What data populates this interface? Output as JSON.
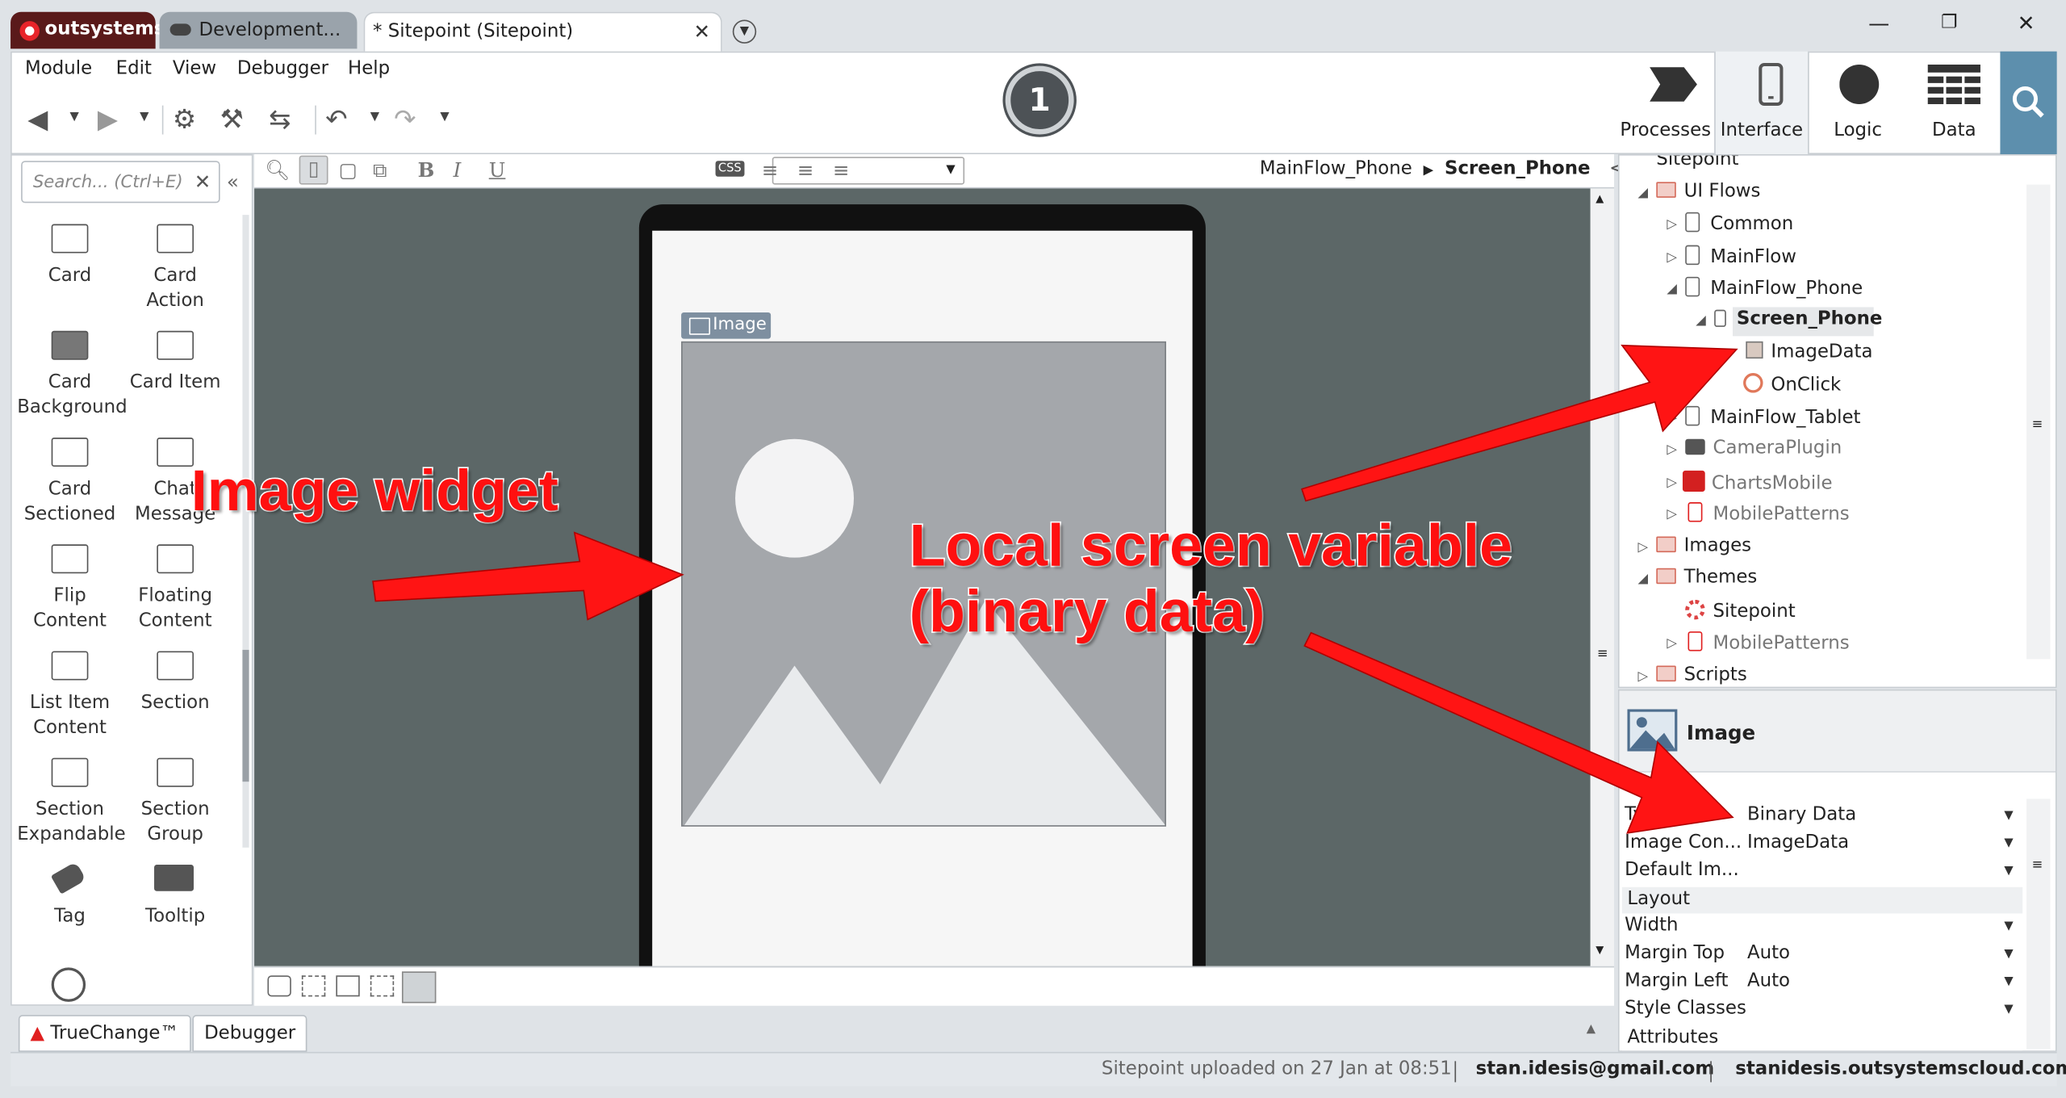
{
  "tabs": {
    "brand": "outsystems",
    "environment": "Development...",
    "module_tab": "* Sitepoint (Sitepoint)",
    "close_glyph": "✕"
  },
  "menu": [
    "Module",
    "Edit",
    "View",
    "Debugger",
    "Help"
  ],
  "step_badge": "1",
  "nav": {
    "processes": "Processes",
    "interface": "Interface",
    "logic": "Logic",
    "data": "Data",
    "active": "Interface"
  },
  "widget_panel": {
    "search_placeholder": "Search... (Ctrl+E)",
    "widgets": [
      {
        "label": "Card",
        "icon": "card-icon"
      },
      {
        "label": "Card Action",
        "icon": "card-action-icon"
      },
      {
        "label": "Card Background",
        "icon": "card-background-icon"
      },
      {
        "label": "Card Item",
        "icon": "card-item-icon"
      },
      {
        "label": "Card Sectioned",
        "icon": "card-sectioned-icon"
      },
      {
        "label": "Chat Message",
        "icon": "chat-message-icon"
      },
      {
        "label": "Flip Content",
        "icon": "flip-content-icon"
      },
      {
        "label": "Floating Content",
        "icon": "floating-content-icon"
      },
      {
        "label": "List Item Content",
        "icon": "list-item-content-icon"
      },
      {
        "label": "Section",
        "icon": "section-icon"
      },
      {
        "label": "Section Expandable",
        "icon": "section-expandable-icon"
      },
      {
        "label": "Section Group",
        "icon": "section-group-icon"
      },
      {
        "label": "Tag",
        "icon": "tag-icon"
      },
      {
        "label": "Tooltip",
        "icon": "tooltip-icon"
      }
    ]
  },
  "canvas": {
    "breadcrumb_flow": "MainFlow_Phone",
    "breadcrumb_screen": "Screen_Phone",
    "image_chip": "Image",
    "css_label": "CSS",
    "bg_color": "#5c6767"
  },
  "tree": {
    "root": "Sitepoint",
    "ui_flows": "UI Flows",
    "common": "Common",
    "mainflow": "MainFlow",
    "mainflow_phone": "MainFlow_Phone",
    "screen_phone": "Screen_Phone",
    "imagedata": "ImageData",
    "onclick": "OnClick",
    "mainflow_tablet": "MainFlow_Tablet",
    "cameraplugin": "CameraPlugin",
    "chartsmobile": "ChartsMobile",
    "mobilepatterns": "MobilePatterns",
    "images": "Images",
    "themes": "Themes",
    "theme_sitepoint": "Sitepoint",
    "theme_mobilepatterns": "MobilePatterns",
    "scripts": "Scripts"
  },
  "properties": {
    "title": "Image",
    "rows": [
      {
        "label": "Type",
        "value": "Binary Data"
      },
      {
        "label": "Image Con...",
        "value": "ImageData"
      },
      {
        "label": "Default Im...",
        "value": ""
      }
    ],
    "layout_section": "Layout",
    "layout_rows": [
      {
        "label": "Width",
        "value": ""
      },
      {
        "label": "Margin Top",
        "value": "Auto"
      },
      {
        "label": "Margin Left",
        "value": "Auto"
      },
      {
        "label": "Style Classes",
        "value": ""
      }
    ],
    "attributes_section": "Attributes"
  },
  "bottom_tabs": {
    "truechange": "TrueChange™",
    "debugger": "Debugger"
  },
  "status": {
    "message": "Sitepoint uploaded on 27 Jan at 08:51",
    "user": "stan.idesis@gmail.com",
    "server": "stanidesis.outsystemscloud.com"
  },
  "annotations": {
    "image_widget": "Image widget",
    "local_var_line1": "Local screen variable",
    "local_var_line2": "(binary data)",
    "color": "#ff1010"
  }
}
